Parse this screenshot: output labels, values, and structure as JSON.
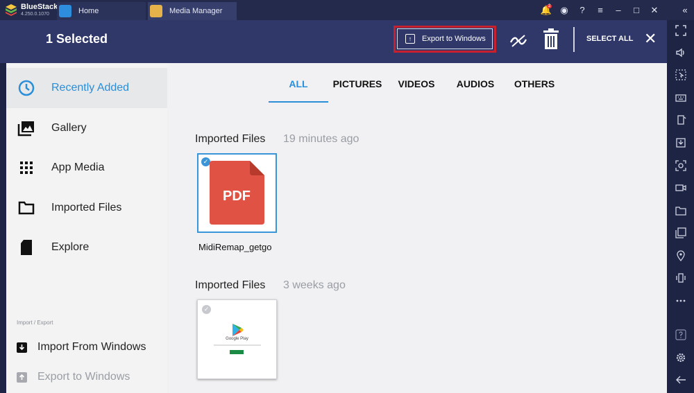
{
  "titlebar": {
    "app_name": "BlueStacks",
    "version": "4.250.0.1070",
    "tabs": [
      {
        "label": "Home",
        "icon": "home-icon"
      },
      {
        "label": "Media Manager",
        "icon": "folder-icon"
      }
    ],
    "notification_count": "2",
    "controls": [
      "bell-icon",
      "account-icon",
      "help-icon",
      "menu-icon",
      "minimize-icon",
      "maximize-icon",
      "close-icon",
      "collapse-sidebar-icon"
    ]
  },
  "header": {
    "selection_label": "1 Selected",
    "export_label": "Export to Windows",
    "select_all_label": "SELECT ALL",
    "close_symbol": "✕"
  },
  "sidebar": {
    "items": [
      {
        "label": "Recently Added",
        "icon": "clock-icon",
        "active": true
      },
      {
        "label": "Gallery",
        "icon": "gallery-icon"
      },
      {
        "label": "App Media",
        "icon": "grid-icon"
      },
      {
        "label": "Imported Files",
        "icon": "folder-icon"
      },
      {
        "label": "Explore",
        "icon": "sd-card-icon"
      }
    ],
    "import_export_caption": "Import / Export",
    "import_label": "Import From Windows",
    "export_label": "Export to Windows"
  },
  "filters": {
    "tabs": [
      "ALL",
      "PICTURES",
      "VIDEOS",
      "AUDIOS",
      "OTHERS"
    ],
    "active": "ALL"
  },
  "sections": [
    {
      "title": "Imported Files",
      "time": "19 minutes ago",
      "files": [
        {
          "name": "MidiRemap_getgo",
          "type": "PDF",
          "selected": true
        }
      ]
    },
    {
      "title": "Imported Files",
      "time": "3 weeks ago",
      "files": [
        {
          "name": "",
          "type": "image",
          "preview_text": "Google Play",
          "selected": false
        }
      ]
    }
  ],
  "right_toolbar": {
    "icons": [
      "fullscreen-icon",
      "volume-icon",
      "cursor-icon",
      "keyboard-icon",
      "rotate-icon",
      "install-apk-icon",
      "screenshot-icon",
      "record-icon",
      "folder-icon",
      "multi-instance-icon",
      "location-icon",
      "shake-icon",
      "more-icon",
      "help-icon",
      "settings-icon",
      "back-icon"
    ]
  },
  "colors": {
    "accent": "#2a8ed8",
    "header_bg": "#30386a",
    "highlight_red": "#c8202e",
    "pdf_red": "#e05243"
  }
}
